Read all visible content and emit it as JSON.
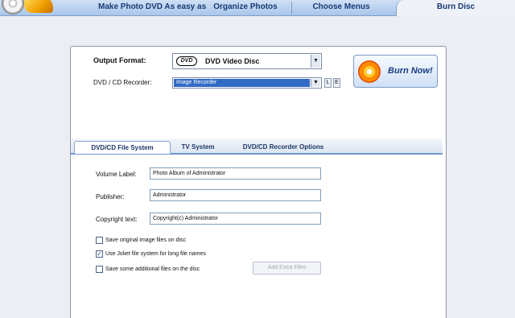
{
  "header": {
    "slogan": "Make Photo DVD As easy as",
    "tabs": [
      {
        "label": "Organize Photos"
      },
      {
        "label": "Choose Menus"
      },
      {
        "label": "Burn Disc"
      }
    ]
  },
  "output": {
    "format_label": "Output Format:",
    "format_logo": "DVD",
    "format_value": "DVD Video Disc",
    "recorder_label": "DVD / CD Recorder:",
    "recorder_value": "Image Recorder",
    "recorder_btn1": "L",
    "recorder_btn2": "E",
    "burn_button": "Burn Now!"
  },
  "tabs": [
    {
      "label": "DVD/CD File System"
    },
    {
      "label": "TV System"
    },
    {
      "label": "DVD/CD Recorder Options"
    }
  ],
  "filesystem": {
    "volume_label": "Volume Label:",
    "volume_value": "Photo Album of Administrator",
    "publisher_label": "Publisher:",
    "publisher_value": "Administrator",
    "copyright_label": "Copyright text:",
    "copyright_value": "Copyright(c) Administrator",
    "options": [
      {
        "label": "Save original image files on disc",
        "checked": false,
        "mark": ""
      },
      {
        "label": "Use Joliet file system for long file names",
        "checked": true,
        "mark": "✓"
      },
      {
        "label": "Save some additional files on the disc",
        "checked": false,
        "mark": ""
      }
    ],
    "add_extra_files": "Add Extra Files"
  }
}
